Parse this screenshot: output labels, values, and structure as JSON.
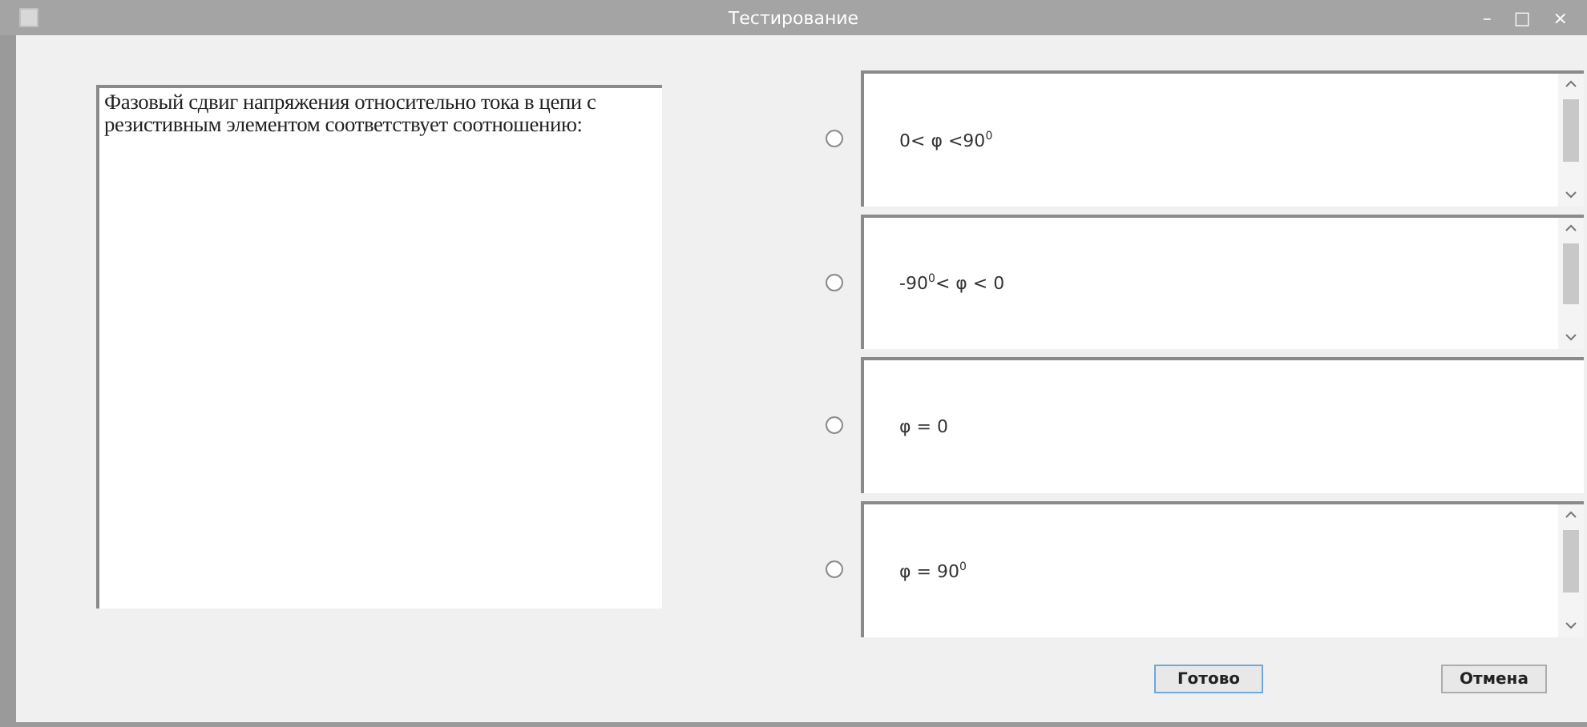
{
  "window": {
    "title": "Тестирование",
    "controls": [
      "–",
      "□",
      "×"
    ]
  },
  "question": "Фазовый сдвиг  напряжения относительно тока в цепи с резистивным элементом соответствует соотношению:",
  "answers": [
    {
      "text": "0< φ <90$^{0}$",
      "selected": false,
      "scrollable": true
    },
    {
      "text": "-90$^{0}$< φ < 0",
      "selected": false,
      "scrollable": true
    },
    {
      "text": "φ = 0",
      "selected": false,
      "scrollable": false
    },
    {
      "text": "φ = 90$^{0}$",
      "selected": false,
      "scrollable": true
    }
  ],
  "buttons": [
    "Готово",
    "Отмена"
  ]
}
